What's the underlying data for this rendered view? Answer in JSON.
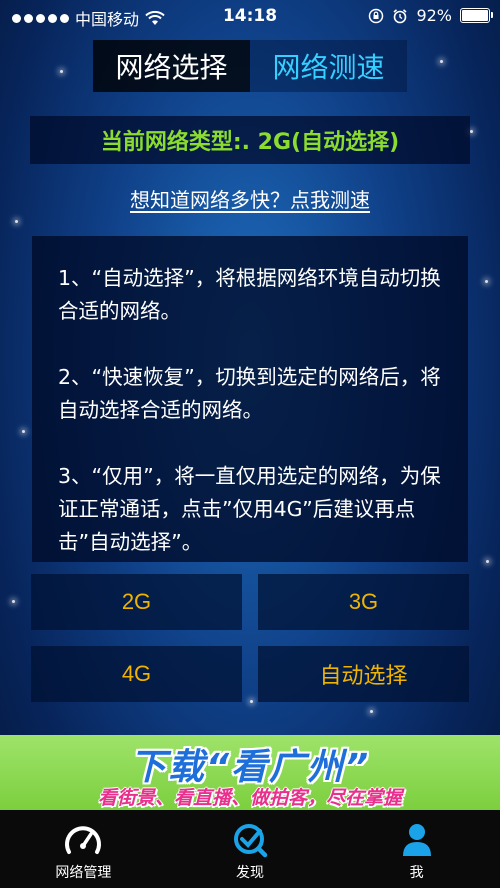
{
  "status_bar": {
    "carrier": "中国移动",
    "time": "14:18",
    "battery": "92%",
    "battery_level": 0.92
  },
  "tabs": [
    {
      "label": "网络选择",
      "active": true
    },
    {
      "label": "网络测速",
      "active": false
    }
  ],
  "network_type": "当前网络类型:. 2G(自动选择)",
  "speed_test_link": "想知道网络多快？点我测速",
  "info": {
    "p1": "1、“自动选择”，将根据网络环境自动切换合适的网络。",
    "p2": "2、“快速恢复”，切换到选定的网络后，将自动选择合适的网络。",
    "p3": "3、“仅用”，将一直仅用选定的网络，为保证正常通话，点击”仅用4G”后建议再点击”自动选择”。"
  },
  "buttons": {
    "b2g": "2G",
    "b3g": "3G",
    "b4g": "4G",
    "auto": "自动选择"
  },
  "banner": {
    "title": "下载“看广州”",
    "subtitle": "看街景、看直播、做拍客，尽在掌握"
  },
  "tabbar": [
    {
      "label": "网络管理",
      "icon": "speedometer-icon"
    },
    {
      "label": "发现",
      "icon": "discover-check-icon"
    },
    {
      "label": "我",
      "icon": "person-icon"
    }
  ],
  "colors": {
    "accent_cyan": "#35d0ff",
    "network_green": "#8bdc2e",
    "button_gold": "#f0b400",
    "tab_active_blue": "#1aa3e8"
  }
}
